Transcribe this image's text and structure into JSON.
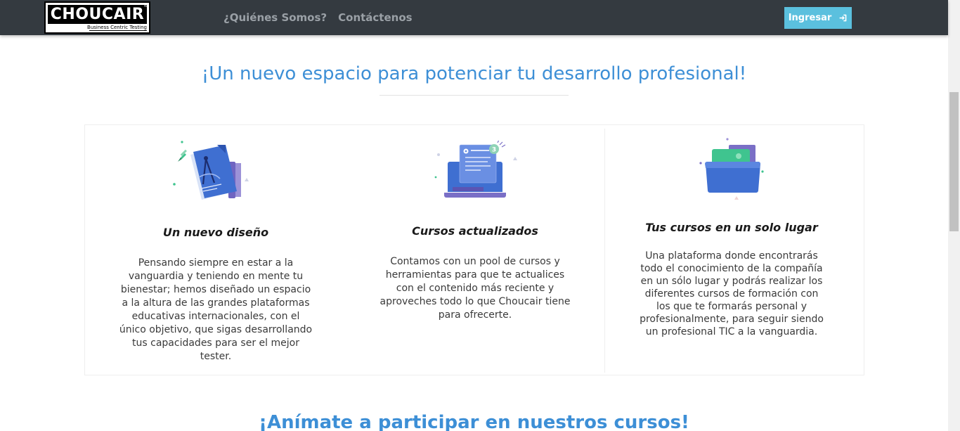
{
  "brand": {
    "logo_text": "CHOUCAIR",
    "logo_tagline": "Business Centric Testing",
    "logo_registered": "®"
  },
  "nav": {
    "links": [
      "¿Quiénes Somos?",
      "Contáctenos"
    ],
    "login_label": "Ingresar",
    "login_icon": "sign-in-icon"
  },
  "hero": {
    "title": "¡Un nuevo espacio para potenciar tu desarrollo profesional!"
  },
  "features": [
    {
      "icon": "design-document-compass-icon",
      "title": "Un nuevo diseño",
      "description": "Pensando siempre en estar a la vanguardia y teniendo en mente tu bienestar; hemos diseñado un espacio a la altura de las grandes plataformas educativas internacionales, con el único objetivo, que sigas desarrollando tus capacidades para ser el mejor tester."
    },
    {
      "icon": "laptop-notification-icon",
      "title": "Cursos actualizados",
      "description": "Contamos con un pool de cursos y herramientas para que te actualices con el contenido más reciente y aproveches todo lo que Choucair tiene para ofrecerte."
    },
    {
      "icon": "folder-files-icon",
      "title": "Tus cursos en un solo lugar",
      "description": "Una plataforma donde encontrarás todo el conocimiento de la compañía en un sólo lugar y podrás realizar los diferentes cursos de formación con los que te formarás personal y profesionalmente, para seguir siendo un profesional TIC a la vanguardia."
    }
  ],
  "cta": {
    "title": "¡Anímate a participar en nuestros cursos!"
  },
  "colors": {
    "navbar": "#343a40",
    "accent": "#3d8fd6",
    "login_button": "#5bc0de",
    "illustration_blue": "#3f6fd1",
    "illustration_purple": "#7a6fc6",
    "illustration_green": "#3fc48f"
  }
}
